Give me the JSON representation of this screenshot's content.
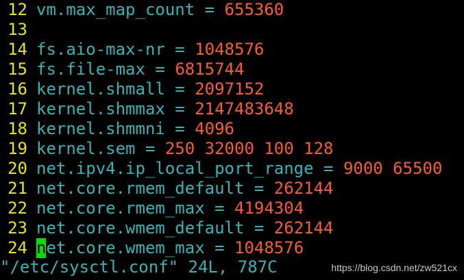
{
  "lines": [
    {
      "num": "12",
      "key": "vm.max_map_count",
      "eq": " = ",
      "value": "655360"
    },
    {
      "num": "13",
      "key": "",
      "eq": "",
      "value": ""
    },
    {
      "num": "14",
      "key": "fs.aio-max-nr",
      "eq": " = ",
      "value": "1048576"
    },
    {
      "num": "15",
      "key": "fs.file-max",
      "eq": " = ",
      "value": "6815744"
    },
    {
      "num": "16",
      "key": "kernel.shmall",
      "eq": " = ",
      "value": "2097152"
    },
    {
      "num": "17",
      "key": "kernel.shmmax",
      "eq": " = ",
      "value": "2147483648"
    },
    {
      "num": "18",
      "key": "kernel.shmmni",
      "eq": " = ",
      "value": "4096"
    },
    {
      "num": "19",
      "key": "kernel.sem",
      "eq": " = ",
      "value": "250 32000 100 128"
    },
    {
      "num": "20",
      "key": "net.ipv4.ip_local_port_range",
      "eq": " = ",
      "value": "9000 65500"
    },
    {
      "num": "21",
      "key": "net.core.rmem_default",
      "eq": " = ",
      "value": "262144"
    },
    {
      "num": "22",
      "key": "net.core.rmem_max",
      "eq": " = ",
      "value": "4194304"
    },
    {
      "num": "23",
      "key": "net.core.wmem_default",
      "eq": " = ",
      "value": "262144"
    },
    {
      "num": "24",
      "cursor_char": "n",
      "key": "et.core.wmem_max",
      "eq": " = ",
      "value": "1048576"
    }
  ],
  "status_line": "\"/etc/sysctl.conf\" 24L, 787C",
  "watermark": "https://blog.csdn.net/zw521cx",
  "colors": {
    "background": "#000000",
    "line_number": "#e6e600",
    "key": "#2fb6b6",
    "value": "#ff5a2a",
    "cursor": "#00e000"
  }
}
